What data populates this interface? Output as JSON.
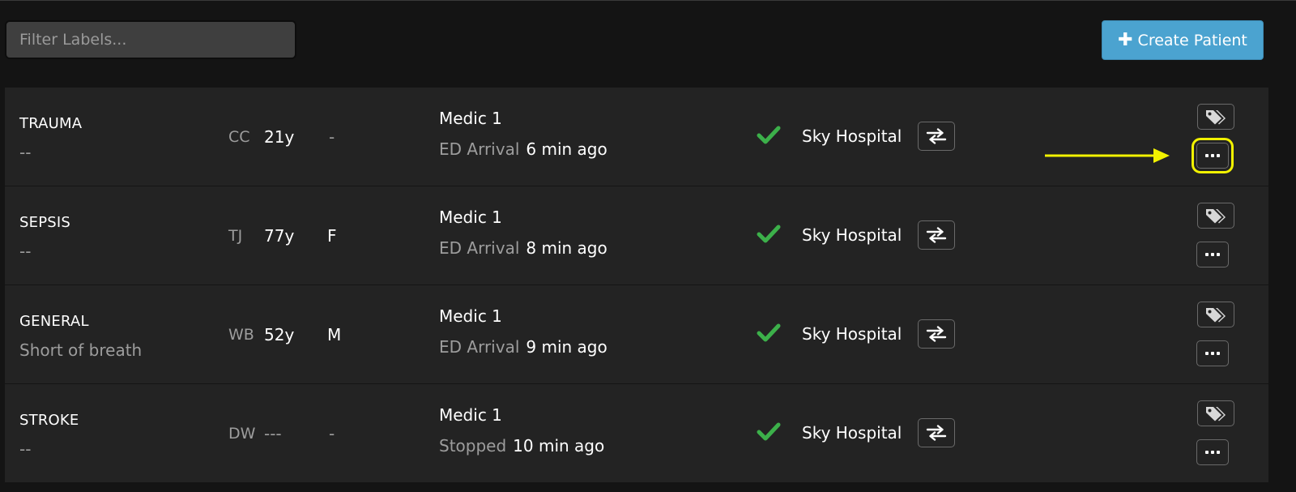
{
  "toolbar": {
    "filter_placeholder": "Filter Labels...",
    "filter_value": "",
    "create_label": "Create Patient",
    "create_icon": "plus-icon"
  },
  "patients": [
    {
      "label": "TRAUMA",
      "complaint": "--",
      "initials": "CC",
      "age": "21y",
      "sex": "-",
      "unit": "Medic 1",
      "status_label": "ED Arrival",
      "status_time": "6 min ago",
      "hospital": "Sky Hospital"
    },
    {
      "label": "SEPSIS",
      "complaint": "--",
      "initials": "TJ",
      "age": "77y",
      "sex": "F",
      "unit": "Medic 1",
      "status_label": "ED Arrival",
      "status_time": "8 min ago",
      "hospital": "Sky Hospital"
    },
    {
      "label": "GENERAL",
      "complaint": "Short of breath",
      "initials": "WB",
      "age": "52y",
      "sex": "M",
      "unit": "Medic 1",
      "status_label": "ED Arrival",
      "status_time": "9 min ago",
      "hospital": "Sky Hospital"
    },
    {
      "label": "STROKE",
      "complaint": "--",
      "initials": "DW",
      "age": "---",
      "sex": "-",
      "unit": "Medic 1",
      "status_label": "Stopped",
      "status_time": "10 min ago",
      "hospital": "Sky Hospital"
    }
  ],
  "colors": {
    "background": "#141414",
    "row_background": "#232323",
    "accent_blue": "#4ba3d0",
    "check_green": "#3cb04a",
    "highlight_yellow": "#f2f200",
    "muted_text": "#9d9d9d"
  },
  "icons": {
    "check": "check-icon",
    "swap": "swap-arrows-icon",
    "tag": "tags-icon",
    "more": "ellipsis-icon"
  }
}
